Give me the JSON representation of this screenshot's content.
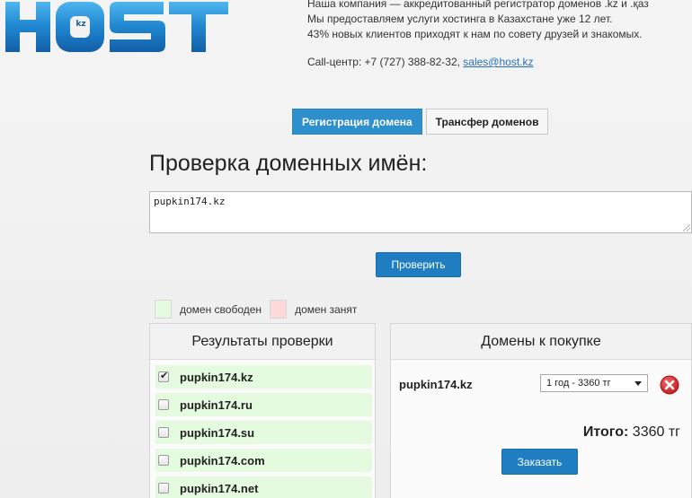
{
  "logo": {
    "text": "HOST",
    "badge": "kz"
  },
  "info": {
    "line1": "Наша компания — аккредитованный регистратор доменов .kz и .қаз",
    "line2": "Мы предоставляем услуги хостинга в Казахстане уже 12 лет.",
    "line3": "43% новых клиентов приходят к нам по совету друзей и знакомых.",
    "callcenter": "Call-центр: +7 (727) 388-82-32, ",
    "email": "sales@host.kz"
  },
  "tabs": [
    {
      "label": "Регистрация домена",
      "active": true
    },
    {
      "label": "Трансфер доменов",
      "active": false
    }
  ],
  "heading": "Проверка доменных имён:",
  "domain_input": {
    "value": "pupkin174.kz"
  },
  "check_button": "Проверить",
  "legend": {
    "free": "домен свободен",
    "taken": "домен занят"
  },
  "results": {
    "title": "Результаты проверки",
    "items": [
      {
        "domain": "pupkin174.kz",
        "checked": true
      },
      {
        "domain": "pupkin174.ru",
        "checked": false
      },
      {
        "domain": "pupkin174.su",
        "checked": false
      },
      {
        "domain": "pupkin174.com",
        "checked": false
      },
      {
        "domain": "pupkin174.net",
        "checked": false
      }
    ]
  },
  "cart": {
    "title": "Домены к покупке",
    "domain": "pupkin174.kz",
    "period": "1 год - 3360 тг",
    "total_label": "Итого:",
    "total_value": " 3360 тг",
    "order_button": "Заказать"
  },
  "colors": {
    "accent": "#2d8fcb",
    "free": "#e4fbdf",
    "taken": "#fdd9d9",
    "remove": "#d9252a"
  },
  "icons": {
    "remove": "remove-icon",
    "resize": "resize-grip-icon"
  }
}
